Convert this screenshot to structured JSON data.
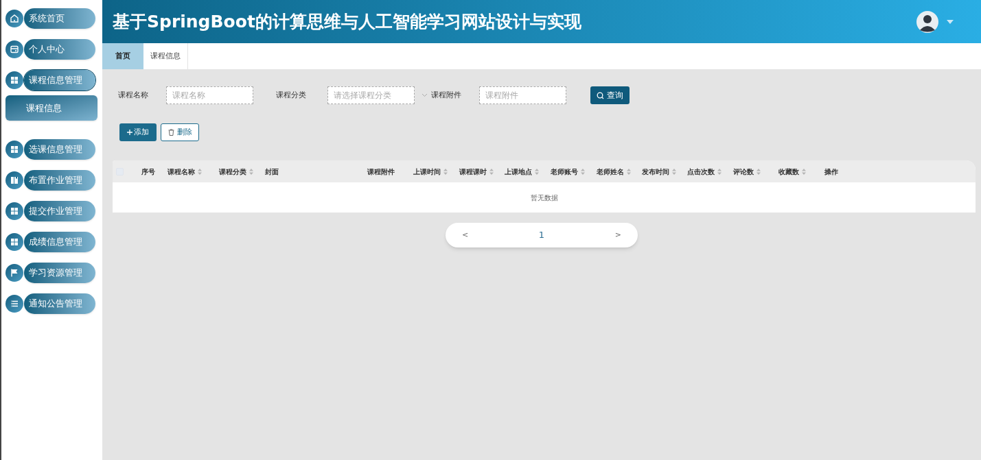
{
  "sidebar": {
    "items": [
      {
        "label": "系统首页",
        "expanded": false
      },
      {
        "label": "个人中心",
        "expanded": false
      },
      {
        "label": "课程信息管理",
        "expanded": true,
        "children": [
          {
            "label": "课程信息",
            "selected": true
          }
        ]
      },
      {
        "label": "选课信息管理",
        "expanded": false
      },
      {
        "label": "布置作业管理",
        "expanded": false
      },
      {
        "label": "提交作业管理",
        "expanded": false
      },
      {
        "label": "成绩信息管理",
        "expanded": false
      },
      {
        "label": "学习资源管理",
        "expanded": false
      },
      {
        "label": "通知公告管理",
        "expanded": false
      }
    ]
  },
  "header": {
    "title": "基于SpringBoot的计算思维与人工智能学习网站设计与实现"
  },
  "tabs": [
    {
      "label": "首页",
      "selected": true
    },
    {
      "label": "课程信息",
      "selected": false
    }
  ],
  "search": {
    "fields": [
      {
        "kind": "text",
        "label": "课程名称",
        "placeholder": "课程名称"
      },
      {
        "kind": "select",
        "label": "课程分类",
        "placeholder": "请选择课程分类"
      },
      {
        "kind": "text",
        "label": "课程附件",
        "placeholder": "课程附件"
      }
    ],
    "button": "查询"
  },
  "actions": {
    "add": "添加",
    "delete": "删除"
  },
  "table": {
    "columns": [
      {
        "label": "序号",
        "sortable": false
      },
      {
        "label": "课程名称",
        "sortable": true
      },
      {
        "label": "课程分类",
        "sortable": true
      },
      {
        "label": "封面",
        "sortable": false
      },
      {
        "label": "课程附件",
        "sortable": false
      },
      {
        "label": "上课时间",
        "sortable": true
      },
      {
        "label": "课程课时",
        "sortable": true
      },
      {
        "label": "上课地点",
        "sortable": true
      },
      {
        "label": "老师账号",
        "sortable": true
      },
      {
        "label": "老师姓名",
        "sortable": true
      },
      {
        "label": "发布时间",
        "sortable": true
      },
      {
        "label": "点击次数",
        "sortable": true
      },
      {
        "label": "评论数",
        "sortable": true
      },
      {
        "label": "收藏数",
        "sortable": true
      },
      {
        "label": "操作",
        "sortable": false
      }
    ],
    "select_all_checked": false,
    "empty_text": "暂无数据"
  },
  "pagination": {
    "prev": "<",
    "pages": [
      {
        "label": "1",
        "selected": true
      }
    ],
    "next": ">"
  }
}
